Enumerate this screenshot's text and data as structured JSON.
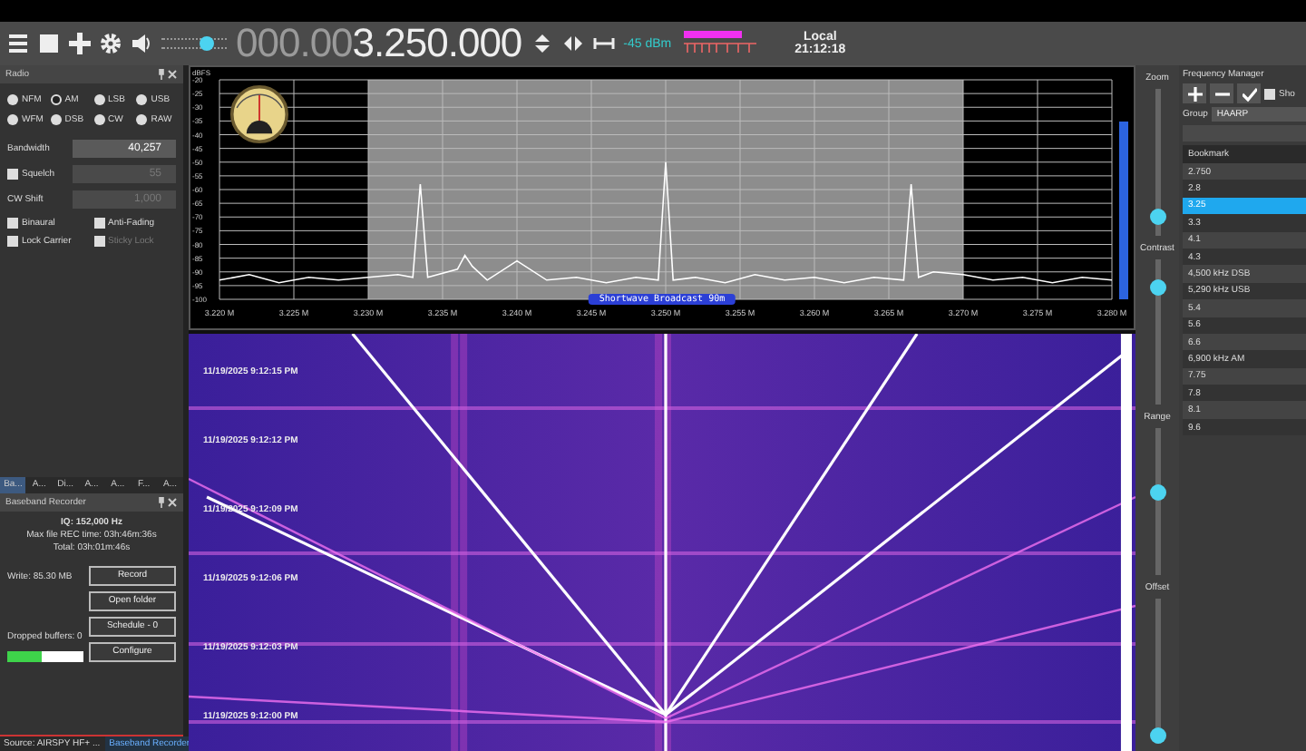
{
  "toolbar": {
    "volume": {
      "level": 0.7
    },
    "frequency_dim": "000.00",
    "frequency": "3.250.000",
    "signal": "-45 dBm",
    "clock_label": "Local",
    "clock_time": "21:12:18"
  },
  "radio": {
    "title": "Radio",
    "modes": [
      {
        "label": "NFM",
        "selected": false
      },
      {
        "label": "AM",
        "selected": true
      },
      {
        "label": "LSB",
        "selected": false
      },
      {
        "label": "USB",
        "selected": false
      },
      {
        "label": "WFM",
        "selected": false
      },
      {
        "label": "DSB",
        "selected": false
      },
      {
        "label": "CW",
        "selected": false
      },
      {
        "label": "RAW",
        "selected": false
      }
    ],
    "fields": [
      {
        "kind": "plain",
        "label": "Bandwidth",
        "value": "40,257",
        "disabled": false
      },
      {
        "kind": "check",
        "label": "Squelch",
        "checked": false,
        "value": "55",
        "disabled": true
      },
      {
        "kind": "plain",
        "label": "CW Shift",
        "value": "1,000",
        "disabled": true
      }
    ],
    "options": [
      {
        "label": "Binaural",
        "checked": false,
        "disabled": false
      },
      {
        "label": "Anti-Fading",
        "checked": false,
        "disabled": false
      },
      {
        "label": "Lock Carrier",
        "checked": false,
        "disabled": false
      },
      {
        "label": "Sticky Lock",
        "checked": false,
        "disabled": true
      }
    ]
  },
  "plugin_tabs": [
    {
      "label": "Ba...",
      "selected": true
    },
    {
      "label": "A...",
      "selected": false
    },
    {
      "label": "Di...",
      "selected": false
    },
    {
      "label": "A...",
      "selected": false
    },
    {
      "label": "A...",
      "selected": false
    },
    {
      "label": "F...",
      "selected": false
    },
    {
      "label": "A...",
      "selected": false
    }
  ],
  "recorder": {
    "title": "Baseband Recorder",
    "iq": "IQ: 152,000 Hz",
    "max_time": "Max file REC time: 03h:46m:36s",
    "total": "Total: 03h:01m:46s",
    "write": "Write: 85.30 MB",
    "dropped": "Dropped buffers: 0",
    "buffer": {
      "level": 0.45
    },
    "buttons": [
      "Record",
      "Open folder",
      "Schedule - 0",
      "Configure"
    ]
  },
  "status_bar": {
    "source": "Source: AIRSPY HF+ ...",
    "tab": "Baseband Recorder"
  },
  "spectrum": {
    "band_label": "Shortwave Broadcast 90m",
    "chart_data": {
      "type": "line",
      "ylabel": "dBFS",
      "xlim": [
        3.22,
        3.28
      ],
      "ylim": [
        -100,
        -20
      ],
      "grid": true,
      "yticks": [
        -20,
        -25,
        -30,
        -35,
        -40,
        -45,
        -50,
        -55,
        -60,
        -65,
        -70,
        -75,
        -80,
        -85,
        -90,
        -95,
        -100
      ],
      "xticks": [
        {
          "value": 3.22,
          "label": "3.220 M"
        },
        {
          "value": 3.225,
          "label": "3.225 M"
        },
        {
          "value": 3.23,
          "label": "3.230 M"
        },
        {
          "value": 3.235,
          "label": "3.235 M"
        },
        {
          "value": 3.24,
          "label": "3.240 M"
        },
        {
          "value": 3.245,
          "label": "3.245 M"
        },
        {
          "value": 3.25,
          "label": "3.250 M"
        },
        {
          "value": 3.255,
          "label": "3.255 M"
        },
        {
          "value": 3.26,
          "label": "3.260 M"
        },
        {
          "value": 3.265,
          "label": "3.265 M"
        },
        {
          "value": 3.27,
          "label": "3.270 M"
        },
        {
          "value": 3.275,
          "label": "3.275 M"
        },
        {
          "value": 3.28,
          "label": "3.280 M"
        }
      ],
      "x": [
        3.22,
        3.222,
        3.224,
        3.226,
        3.228,
        3.23,
        3.232,
        3.233,
        3.2335,
        3.234,
        3.236,
        3.2365,
        3.237,
        3.238,
        3.24,
        3.242,
        3.244,
        3.246,
        3.248,
        3.2495,
        3.25,
        3.2505,
        3.252,
        3.254,
        3.256,
        3.258,
        3.26,
        3.262,
        3.264,
        3.266,
        3.2665,
        3.267,
        3.268,
        3.27,
        3.272,
        3.274,
        3.276,
        3.278,
        3.28
      ],
      "series": [
        {
          "color": "#ffffff",
          "values": [
            -93,
            -91,
            -94,
            -92,
            -93,
            -92,
            -91,
            -92,
            -58,
            -92,
            -89,
            -84,
            -88,
            -93,
            -86,
            -93,
            -92,
            -94,
            -92,
            -93,
            -50,
            -93,
            -92,
            -94,
            -91,
            -93,
            -92,
            -94,
            -92,
            -93,
            -58,
            -92,
            -90,
            -91,
            -93,
            -92,
            -94,
            -92,
            -93
          ]
        }
      ]
    }
  },
  "waterfall": {
    "timestamps": [
      "11/19/2025 9:12:15 PM",
      "11/19/2025 9:12:12 PM",
      "11/19/2025 9:12:09 PM",
      "11/19/2025 9:12:06 PM",
      "11/19/2025 9:12:03 PM",
      "11/19/2025 9:12:00 PM"
    ]
  },
  "sliders": [
    {
      "label": "Zoom",
      "level": 0.12
    },
    {
      "label": "Contrast",
      "level": 0.8
    },
    {
      "label": "Range",
      "level": 0.55
    },
    {
      "label": "Offset",
      "level": 0.05
    }
  ],
  "frequency_manager": {
    "title": "Frequency Manager",
    "show_label": "Sho",
    "show_checked": false,
    "group_label": "Group",
    "group": "HAARP",
    "column": "Bookmark",
    "bookmarks": [
      {
        "name": "2.750",
        "selected": false
      },
      {
        "name": "2.8",
        "selected": false
      },
      {
        "name": "3.25",
        "selected": true
      },
      {
        "name": "3.3",
        "selected": false
      },
      {
        "name": "4.1",
        "selected": false
      },
      {
        "name": "4.3",
        "selected": false
      },
      {
        "name": "4,500 kHz DSB",
        "selected": false
      },
      {
        "name": "5,290 kHz USB",
        "selected": false
      },
      {
        "name": "5.4",
        "selected": false
      },
      {
        "name": "5.6",
        "selected": false
      },
      {
        "name": "6.6",
        "selected": false
      },
      {
        "name": "6,900 kHz AM",
        "selected": false
      },
      {
        "name": "7.75",
        "selected": false
      },
      {
        "name": "7.8",
        "selected": false
      },
      {
        "name": "8.1",
        "selected": false
      },
      {
        "name": "9.6",
        "selected": false
      }
    ]
  }
}
